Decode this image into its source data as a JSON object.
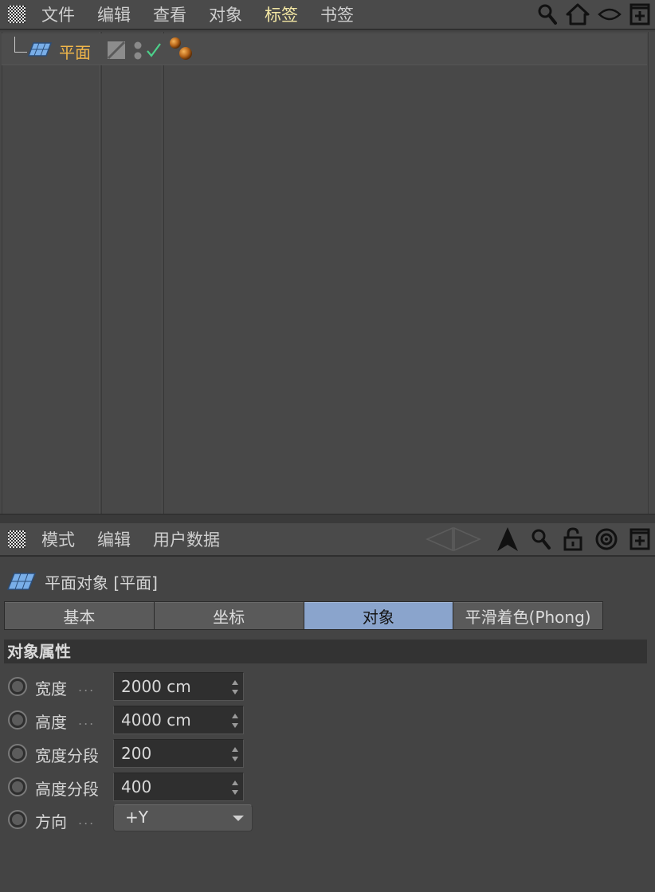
{
  "object_manager": {
    "menu": [
      {
        "label": "文件"
      },
      {
        "label": "编辑"
      },
      {
        "label": "查看"
      },
      {
        "label": "对象"
      },
      {
        "label": "标签"
      },
      {
        "label": "书签"
      }
    ],
    "objects": [
      {
        "name": "平面",
        "icon": "plane-object-icon",
        "color": "#f0b64a"
      }
    ]
  },
  "attribute_manager": {
    "menu": [
      {
        "label": "模式"
      },
      {
        "label": "编辑"
      },
      {
        "label": "用户数据"
      }
    ],
    "title": "平面对象 [平面]",
    "tabs": [
      {
        "label": "基本"
      },
      {
        "label": "坐标"
      },
      {
        "label": "对象"
      },
      {
        "label": "平滑着色(Phong)"
      }
    ],
    "section": "对象属性",
    "params": [
      {
        "label": "宽度",
        "dots": "...",
        "value": "2000 cm"
      },
      {
        "label": "高度",
        "dots": "...",
        "value": "4000 cm"
      },
      {
        "label": "宽度分段",
        "dots": "",
        "value": "200"
      },
      {
        "label": "高度分段",
        "dots": "",
        "value": "400"
      }
    ],
    "orientation": {
      "label": "方向",
      "dots": "...",
      "value": "+Y"
    }
  },
  "colors": {
    "accent_tab": "#8aa4cc",
    "active_menu": "#f2e6a3",
    "object_name": "#f0b64a",
    "checkmark": "#4cd08a"
  }
}
